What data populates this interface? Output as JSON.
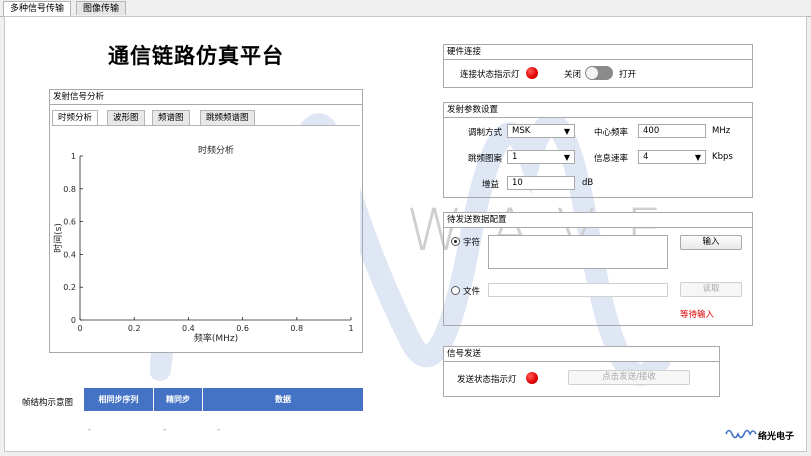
{
  "tabs": [
    "多种信号传输",
    "图像传输"
  ],
  "title": "通信链路仿真平台",
  "watermark": "LUO WAVE",
  "analysis": {
    "panel_title": "发射信号分析",
    "subtabs": [
      "时频分析",
      "波形图",
      "频谱图",
      "跳频频谱图"
    ],
    "plot_title": "时频分析",
    "xlabel": "频率(MHz)",
    "ylabel": "时间(s)"
  },
  "chart_data": {
    "type": "line",
    "title": "时频分析",
    "xlabel": "频率(MHz)",
    "ylabel": "时间(s)",
    "xlim": [
      0,
      1
    ],
    "ylim": [
      0,
      1
    ],
    "xticks": [
      "0",
      "0.2",
      "0.4",
      "0.6",
      "0.8",
      "1"
    ],
    "yticks": [
      "0",
      "0.2",
      "0.4",
      "0.6",
      "0.8",
      "1"
    ],
    "series": [],
    "grid": false
  },
  "hardware": {
    "panel_title": "硬件连接",
    "status_label": "连接状态指示灯",
    "status_color": "#e00000",
    "off_label": "关闭",
    "on_label": "打开"
  },
  "params": {
    "panel_title": "发射参数设置",
    "modulation_label": "调制方式",
    "modulation_value": "MSK",
    "center_freq_label": "中心频率",
    "center_freq_value": "400",
    "center_freq_unit": "MHz",
    "hop_label": "跳频图案",
    "hop_value": "1",
    "rate_label": "信息速率",
    "rate_value": "4",
    "rate_unit": "Kbps",
    "gain_label": "增益",
    "gain_value": "10",
    "gain_unit": "dB"
  },
  "data_config": {
    "panel_title": "待发送数据配置",
    "char_label": "字符",
    "file_label": "文件",
    "input_button": "输入",
    "read_button": "读取",
    "status": "等待输入"
  },
  "send": {
    "panel_title": "信号发送",
    "status_label": "发送状态指示灯",
    "send_button": "点击发送/接收"
  },
  "frame": {
    "label": "帧结构示意图",
    "columns": [
      "相同步序列",
      "精同步",
      "数据"
    ],
    "dashes": [
      "-",
      "-",
      "-"
    ]
  },
  "logo_text": "络光电子"
}
